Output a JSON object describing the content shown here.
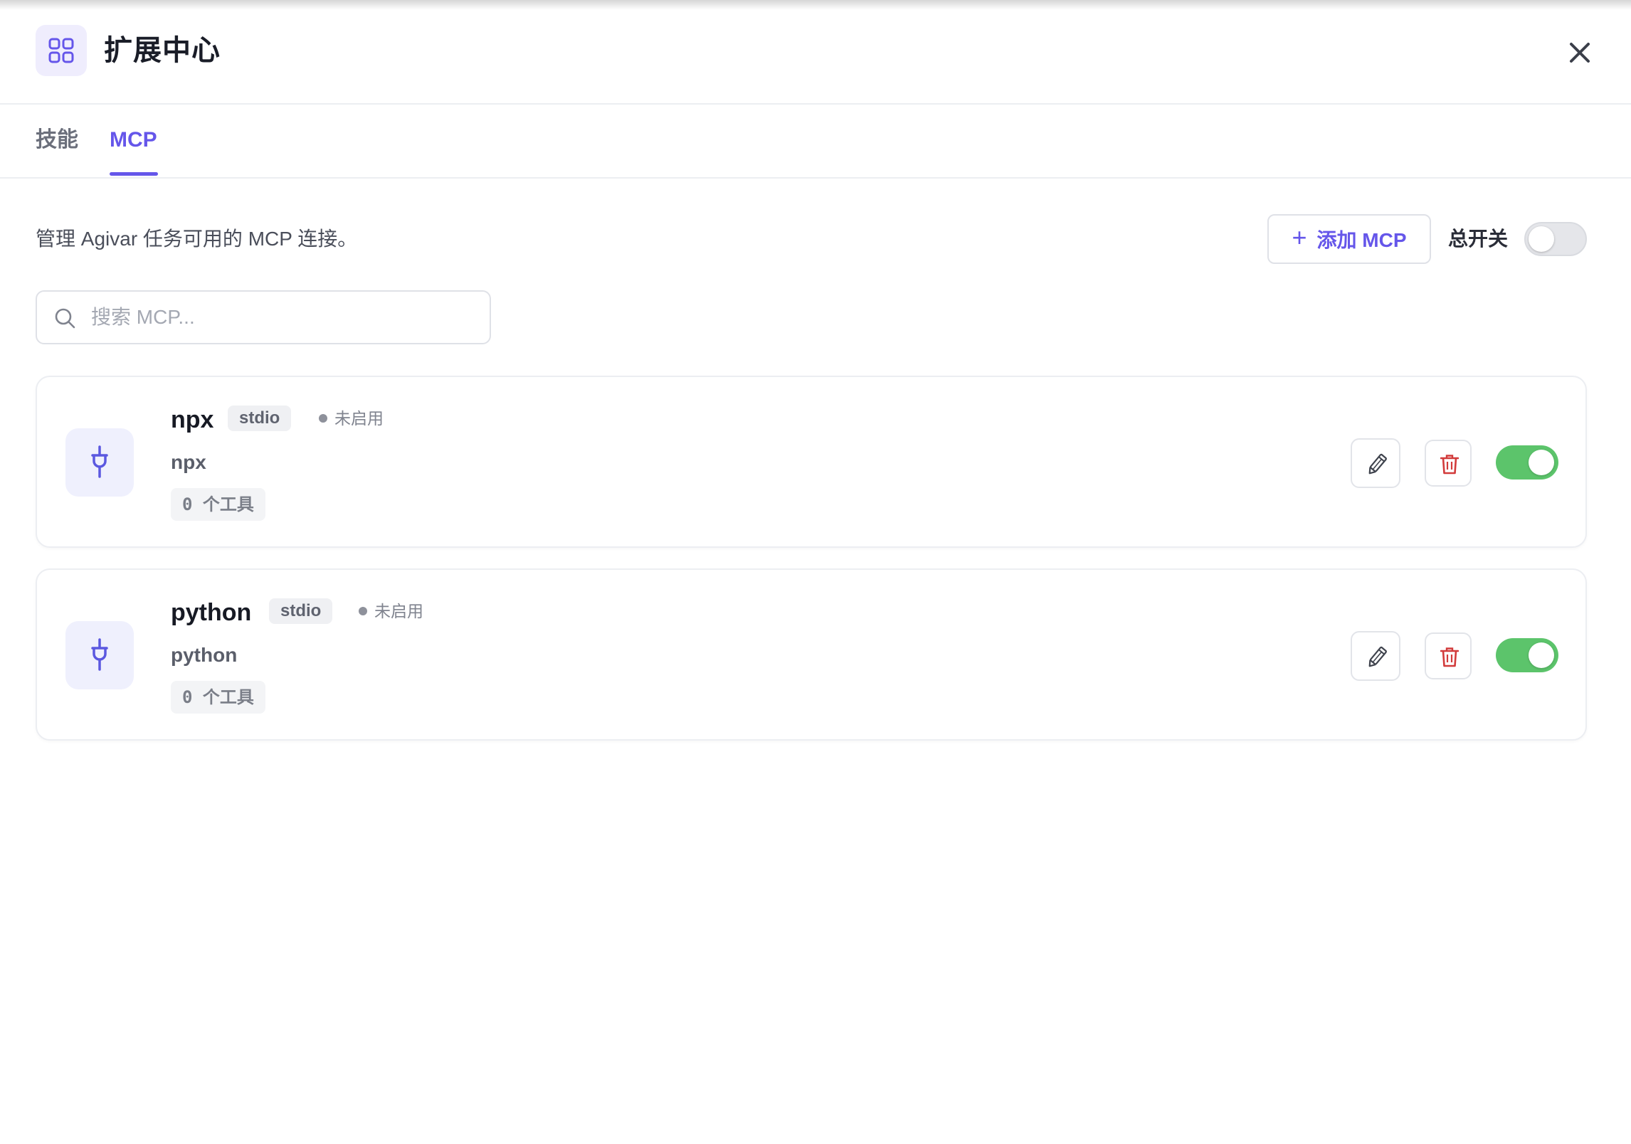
{
  "header": {
    "app_icon": "grid-icon",
    "title": "扩展中心",
    "close_icon": "close-icon"
  },
  "tabs": [
    {
      "label": "技能",
      "active": false
    },
    {
      "label": "MCP",
      "active": true
    }
  ],
  "toolbar": {
    "description": "管理 Agivar 任务可用的 MCP 连接。",
    "add_plus": "+",
    "add_label": "添加 MCP",
    "master_switch_label": "总开关",
    "master_switch_on": false
  },
  "search": {
    "placeholder": "搜索 MCP...",
    "value": ""
  },
  "colors": {
    "accent": "#6556ea",
    "toggle_on": "#5cc46b",
    "delete": "#d23b3b"
  },
  "servers": [
    {
      "name": "npx",
      "transport": "stdio",
      "status": "未启用",
      "command": "npx",
      "tools": "0 个工具",
      "enabled": true
    },
    {
      "name": "python",
      "transport": "stdio",
      "status": "未启用",
      "command": "python",
      "tools": "0 个工具",
      "enabled": true
    }
  ]
}
